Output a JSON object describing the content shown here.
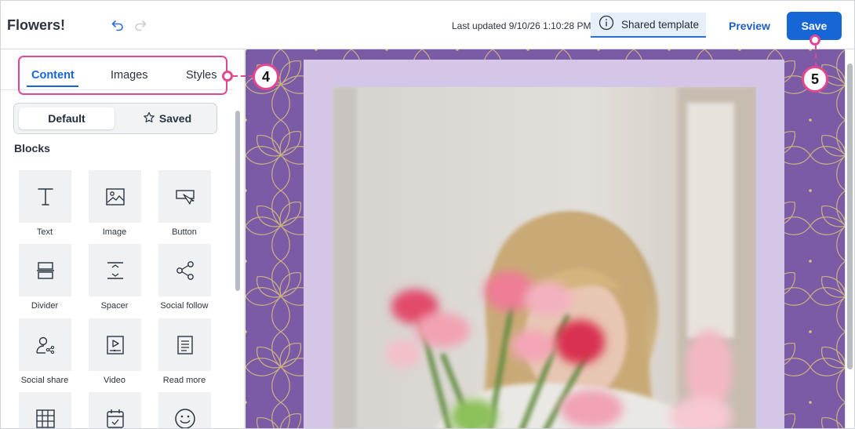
{
  "header": {
    "title": "Flowers!",
    "last_updated": "Last updated 9/10/26 1:10:28 PM",
    "shared_template_label": "Shared template",
    "preview_label": "Preview",
    "save_label": "Save"
  },
  "panel": {
    "tabs": [
      {
        "label": "Content",
        "active": true
      },
      {
        "label": "Images",
        "active": false
      },
      {
        "label": "Styles",
        "active": false
      }
    ],
    "segment": {
      "default_label": "Default",
      "saved_label": "Saved"
    },
    "blocks_heading": "Blocks",
    "blocks": [
      {
        "label": "Text",
        "icon": "text-icon"
      },
      {
        "label": "Image",
        "icon": "image-icon"
      },
      {
        "label": "Button",
        "icon": "button-icon"
      },
      {
        "label": "Divider",
        "icon": "divider-icon"
      },
      {
        "label": "Spacer",
        "icon": "spacer-icon"
      },
      {
        "label": "Social follow",
        "icon": "share-icon"
      },
      {
        "label": "Social share",
        "icon": "social-share-icon"
      },
      {
        "label": "Video",
        "icon": "video-icon"
      },
      {
        "label": "Read more",
        "icon": "read-more-icon"
      },
      {
        "label": "",
        "icon": "table-icon"
      },
      {
        "label": "",
        "icon": "calendar-icon"
      },
      {
        "label": "",
        "icon": "emoji-icon"
      }
    ]
  },
  "callouts": [
    {
      "number": "4",
      "target": "tabs"
    },
    {
      "number": "5",
      "target": "save-button"
    }
  ],
  "colors": {
    "accent_blue": "#1766d6",
    "callout_pink": "#e2478f",
    "canvas_purple": "#7b5aa6",
    "card_lavender": "#d4c6e6"
  }
}
